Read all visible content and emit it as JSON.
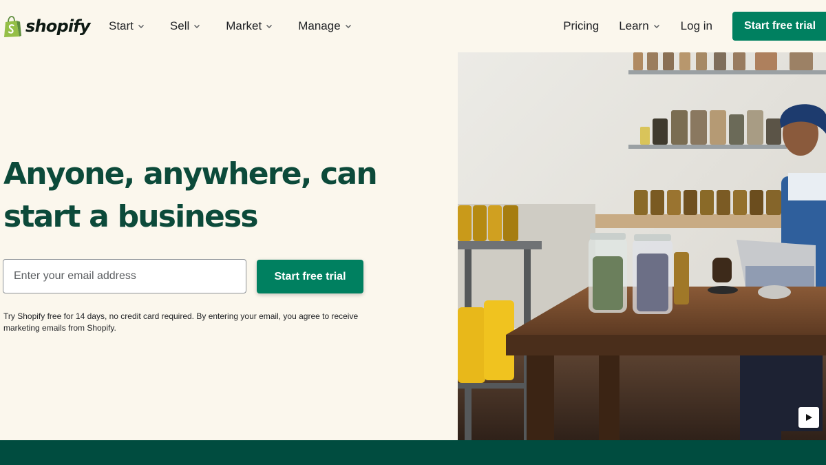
{
  "brand": {
    "name": "shopify",
    "accent": "#008060",
    "heading_color": "#0c4a3a",
    "band_color": "#004c3f",
    "background": "#fbf7ed"
  },
  "header": {
    "nav_left": [
      {
        "label": "Start",
        "icon": "chevron-down-icon"
      },
      {
        "label": "Sell",
        "icon": "chevron-down-icon"
      },
      {
        "label": "Market",
        "icon": "chevron-down-icon"
      },
      {
        "label": "Manage",
        "icon": "chevron-down-icon"
      }
    ],
    "pricing_label": "Pricing",
    "learn_label": "Learn",
    "login_label": "Log in",
    "cta_label": "Start free trial"
  },
  "hero": {
    "title_line1": "Anyone, anywhere, can",
    "title_line2": "start a business",
    "email_placeholder": "Enter your email address",
    "email_value": "",
    "cta_label": "Start free trial",
    "fineprint": "Try Shopify free for 14 days, no credit card required. By entering your email, you agree to receive marketing emails from Shopify."
  },
  "media": {
    "play_icon": "play-icon"
  }
}
